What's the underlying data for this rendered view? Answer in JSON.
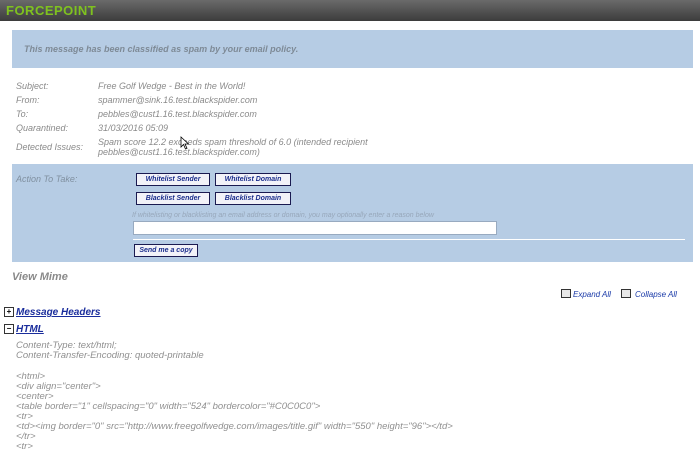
{
  "header": {
    "brand": "FORCEPOINT",
    "brand_color": "#7fc21f"
  },
  "banner": {
    "text": "This message has been classified as spam by your email policy."
  },
  "details": [
    {
      "label": "Subject:",
      "value": "Free Golf Wedge - Best in the World!"
    },
    {
      "label": "From:",
      "value": "spammer@sink.16.test.blackspider.com"
    },
    {
      "label": "To:",
      "value": "pebbles@cust1.16.test.blackspider.com"
    },
    {
      "label": "Quarantined:",
      "value": "31/03/2016 05:09"
    },
    {
      "label": "Detected Issues:",
      "value_line1": "Spam score 12.2 exceeds spam threshold of 6.0 (intended recipient",
      "value_line2": "pebbles@cust1.16.test.blackspider.com)"
    }
  ],
  "action": {
    "label": "Action To Take:",
    "whitelist_sender": "Whitelist Sender",
    "whitelist_domain": "Whitelist Domain",
    "blacklist_sender": "Blacklist Sender",
    "blacklist_domain": "Blacklist Domain",
    "hint": "If whitelisting or blacklisting an email address or domain, you may optionally enter a reason below",
    "reason_value": "",
    "send_copy": "Send me a copy"
  },
  "mime": {
    "title": "View Mime",
    "expand_all": "Expand All",
    "collapse_all": "Collapse All",
    "sections": [
      {
        "label": "Message Headers",
        "expanded": false
      },
      {
        "label": "HTML",
        "expanded": true
      }
    ],
    "content_type": "Content-Type: text/html;",
    "transfer_encoding": "Content-Transfer-Encoding: quoted-printable",
    "code_lines": [
      "<html>",
      "<div align=\"center\">",
      "<center>",
      "<table border=\"1\" cellspacing=\"0\" width=\"524\" bordercolor=\"#C0C0C0\">",
      "<tr>",
      "<td><img border=\"0\" src=\"http://www.freegolfwedge.com/images/title.gif\" width=\"550\" height=\"96\"></td>",
      "</tr>",
      "<tr>"
    ]
  }
}
